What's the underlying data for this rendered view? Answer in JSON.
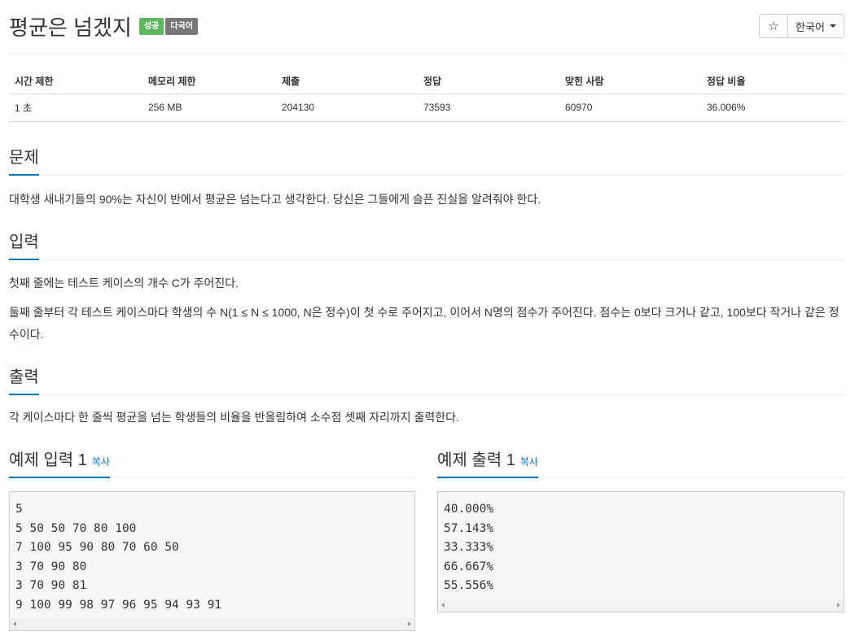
{
  "header": {
    "title": "평균은 넘겠지",
    "badge_success": "성공",
    "badge_multilang": "다국어",
    "star_icon": "☆",
    "language_label": "한국어"
  },
  "info": {
    "headers": [
      "시간 제한",
      "메모리 제한",
      "제출",
      "정답",
      "맞힌 사람",
      "정답 비율"
    ],
    "values": [
      "1 초",
      "256 MB",
      "204130",
      "73593",
      "60970",
      "36.006%"
    ]
  },
  "problem": {
    "heading": "문제",
    "text": "대학생 새내기들의 90%는 자신이 반에서 평균은 넘는다고 생각한다. 당신은 그들에게 슬픈 진실을 알려줘야 한다."
  },
  "input": {
    "heading": "입력",
    "line1": "첫째 줄에는 테스트 케이스의 개수 C가 주어진다.",
    "line2": "둘째 줄부터 각 테스트 케이스마다 학생의 수 N(1 ≤ N ≤ 1000, N은 정수)이 첫 수로 주어지고, 이어서 N명의 점수가 주어진다. 점수는 0보다 크거나 같고, 100보다 작거나 같은 정수이다."
  },
  "output": {
    "heading": "출력",
    "text": "각 케이스마다 한 줄씩 평균을 넘는 학생들의 비율을 반올림하여 소수점 셋째 자리까지 출력한다."
  },
  "sample_input": {
    "heading": "예제 입력 1",
    "copy_label": "복사",
    "content": "5\n5 50 50 70 80 100\n7 100 95 90 80 70 60 50\n3 70 90 80\n3 70 90 81\n9 100 99 98 97 96 95 94 93 91"
  },
  "sample_output": {
    "heading": "예제 출력 1",
    "copy_label": "복사",
    "content": "40.000%\n57.143%\n33.333%\n66.667%\n55.556%"
  }
}
